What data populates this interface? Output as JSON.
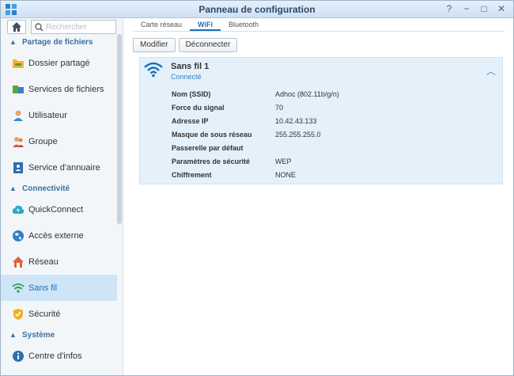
{
  "window": {
    "title": "Panneau de configuration"
  },
  "sidebar": {
    "search_placeholder": "Rechercher",
    "sections": [
      {
        "label": "Partage de fichiers"
      },
      {
        "label": "Connectivité"
      },
      {
        "label": "Système"
      }
    ],
    "items": [
      {
        "label": "Dossier partagé",
        "icon": "folder-icon"
      },
      {
        "label": "Services de fichiers",
        "icon": "file-services-icon"
      },
      {
        "label": "Utilisateur",
        "icon": "user-icon"
      },
      {
        "label": "Groupe",
        "icon": "group-icon"
      },
      {
        "label": "Service d'annuaire",
        "icon": "directory-icon"
      },
      {
        "label": "QuickConnect",
        "icon": "quickconnect-icon"
      },
      {
        "label": "Accès externe",
        "icon": "globe-icon"
      },
      {
        "label": "Réseau",
        "icon": "network-icon"
      },
      {
        "label": "Sans fil",
        "icon": "wifi-icon"
      },
      {
        "label": "Sécurité",
        "icon": "shield-icon"
      },
      {
        "label": "Centre d'infos",
        "icon": "info-icon"
      }
    ]
  },
  "tabs": [
    {
      "label": "Carte réseau"
    },
    {
      "label": "WiFi"
    },
    {
      "label": "Bluetooth"
    }
  ],
  "toolbar": {
    "modify_label": "Modifier",
    "disconnect_label": "Déconnecter"
  },
  "connection": {
    "title": "Sans fil 1",
    "status": "Connecté",
    "fields": [
      {
        "key": "Nom (SSID)",
        "value": "Adhoc (802.11b/g/n)"
      },
      {
        "key": "Force du signal",
        "value": "70"
      },
      {
        "key": "Adresse IP",
        "value": "10.42.43.133"
      },
      {
        "key": "Masque de sous réseau",
        "value": "255.255.255.0"
      },
      {
        "key": "Passerelle par défaut",
        "value": ""
      },
      {
        "key": "Paramètres de sécurité",
        "value": "WEP"
      },
      {
        "key": "Chiffrement",
        "value": "NONE"
      }
    ]
  },
  "colors": {
    "accent": "#1d6fb8",
    "active_bg": "#cde5f6",
    "card_bg": "#e4f1fb"
  }
}
